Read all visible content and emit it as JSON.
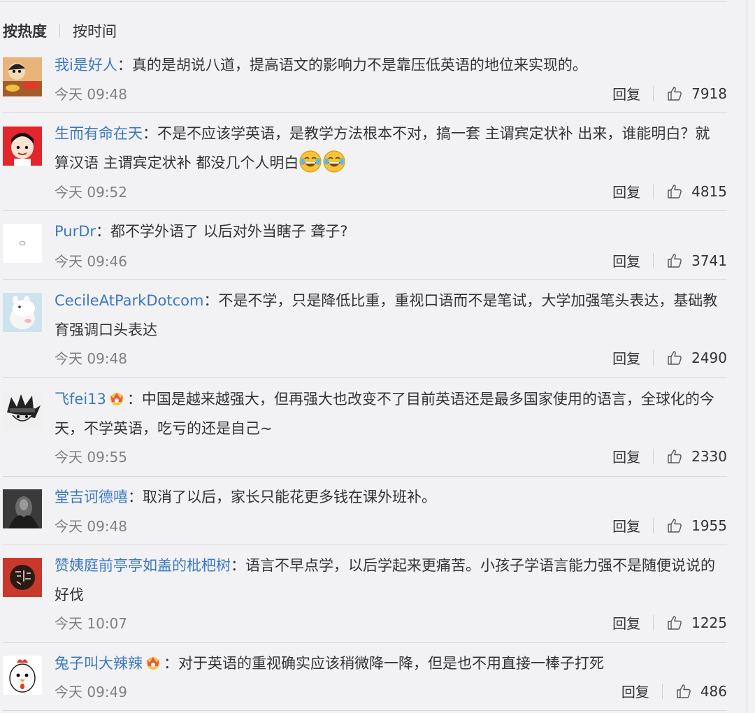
{
  "sort": {
    "hot": "按热度",
    "time": "按时间"
  },
  "comments": [
    {
      "user": "我i是好人",
      "text": "：真的是胡说八道，提高语文的影响力不是靠压低英语的地位来实现的。",
      "time": "今天 09:48",
      "reply": "回复",
      "likes": "7918",
      "avatar": "cartoon-avatar"
    },
    {
      "user": "生而有命在天",
      "text": "：不是不应该学英语，是教学方法根本不对，搞一套 主谓宾定状补 出来，谁能明白？就算汉语 主谓宾定状补 都没几个人明白",
      "emoji": "laugh-cry-emoji",
      "time": "今天 09:52",
      "reply": "回复",
      "likes": "4815",
      "avatar": "red-character-avatar"
    },
    {
      "user": "PurDr",
      "text": "：都不学外语了 以后对外当瞎子 聋子?",
      "time": "今天 09:46",
      "reply": "回复",
      "likes": "3741",
      "avatar": "white-avatar"
    },
    {
      "user": "CecileAtParkDotcom",
      "text": "：不是不学，只是降低比重，重视口语而不是笔试，大学加强笔头表达，基础教育强调口头表达",
      "time": "今天 09:48",
      "reply": "回复",
      "likes": "2490",
      "avatar": "moomin-avatar"
    },
    {
      "user": "飞fei13",
      "text": "：中国是越来越强大，但再强大也改变不了目前英语还是最多国家使用的语言，全球化的今天，不学英语，吃亏的还是自己~",
      "badge": "vip-crown-icon",
      "time": "今天 09:55",
      "reply": "回复",
      "likes": "2330",
      "avatar": "manga-avatar"
    },
    {
      "user": "堂吉诃德嘻",
      "text": "：取消了以后，家长只能花更多钱在课外班补。",
      "time": "今天 09:48",
      "reply": "回复",
      "likes": "1955",
      "avatar": "dark-photo-avatar"
    },
    {
      "user": "赞姨庭前亭亭如盖的枇杷树",
      "text": "：语言不早点学，以后学起来更痛苦。小孩子学语言能力强不是随便说说的好伐",
      "time": "今天 10:07",
      "reply": "回复",
      "likes": "1225",
      "avatar": "red-seal-avatar"
    },
    {
      "user": "兔子叫大辣辣",
      "text": "：对于英语的重视确实应该稍微降一降，但是也不用直接一棒子打死",
      "badge": "vip-crown-icon",
      "time": "今天 09:49",
      "reply": "回复",
      "likes": "486",
      "avatar": "chicken-avatar"
    }
  ],
  "colors": {
    "username": "#3b78c2",
    "text": "#333333",
    "time": "#808080",
    "background": "#f2f2f5"
  }
}
